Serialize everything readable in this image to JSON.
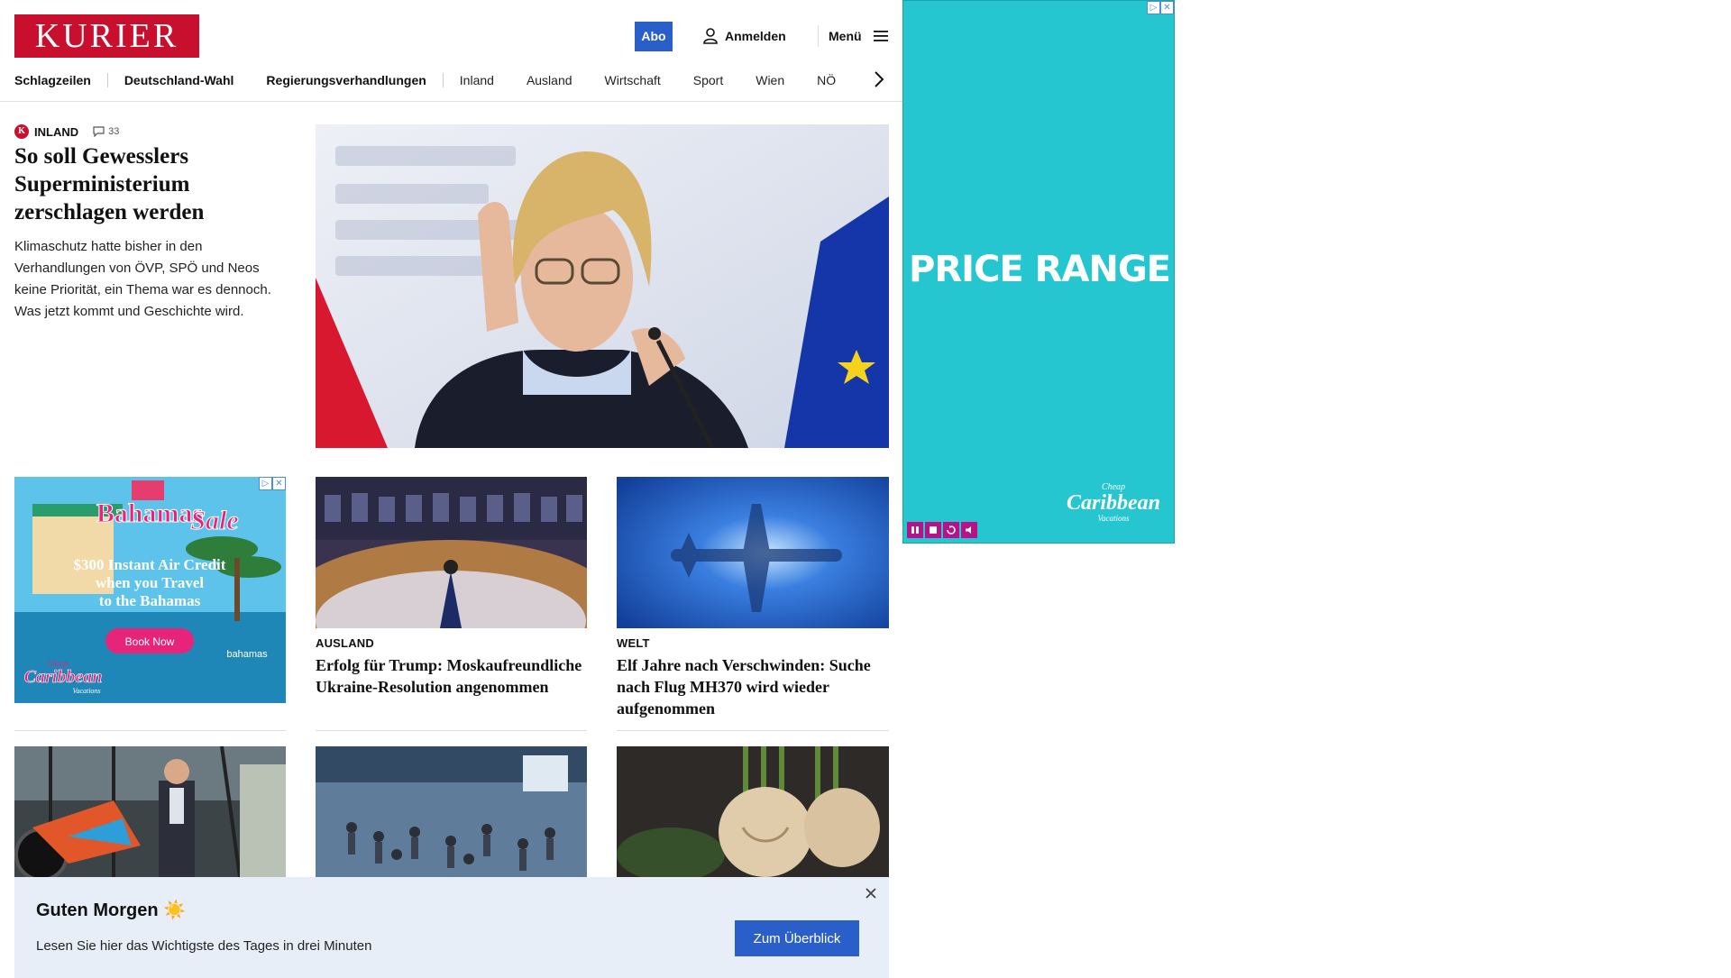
{
  "header": {
    "logo_text": "KURIER",
    "abo_label": "Abo",
    "login_label": "Anmelden",
    "menu_label": "Menü"
  },
  "nav": {
    "items": [
      {
        "label": "Schlagzeilen"
      },
      {
        "label": "Deutschland-Wahl"
      },
      {
        "label": "Regierungsverhandlungen"
      },
      {
        "label": "Inland"
      },
      {
        "label": "Ausland"
      },
      {
        "label": "Wirtschaft"
      },
      {
        "label": "Sport"
      },
      {
        "label": "Wien"
      },
      {
        "label": "NÖ"
      }
    ]
  },
  "lead": {
    "badge_letter": "K",
    "kicker": "INLAND",
    "comment_count": "33",
    "title": "So soll Gewesslers Superministerium zerschlagen werden",
    "teaser": "Klimaschutz hatte bisher in den Verhandlungen von ÖVP, SPÖ und Neos keine Priorität, ein Thema war es dennoch. Was jetzt kommt und Geschichte wird."
  },
  "cards": [
    {
      "kicker": "AUSLAND",
      "title": "Erfolg für Trump: Moskaufreundliche Ukraine-Resolution angenommen"
    },
    {
      "kicker": "WELT",
      "title": "Elf Jahre nach Verschwinden: Suche nach Flug MH370 wird wieder aufgenommen"
    }
  ],
  "ad_bahamas": {
    "headline_1": "Bahamas",
    "headline_2": "Sale",
    "offer_line_1": "$300 Instant Air Credit",
    "offer_line_2": "when you Travel",
    "offer_line_3": "to the Bahamas",
    "cta": "Book Now",
    "brand_small": "Cheap",
    "brand_main": "Caribbean",
    "brand_sub": "Vacations",
    "partner": "bahamas"
  },
  "ad_right": {
    "headline": "PRICE RANGE",
    "brand_small": "Cheap",
    "brand_main": "Caribbean",
    "brand_sub": "Vacations"
  },
  "greeting": {
    "title": "Guten Morgen",
    "emoji": "☀️",
    "subtitle": "Lesen Sie hier das Wichtigste des Tages in drei Minuten",
    "button": "Zum Überblick"
  },
  "colors": {
    "brand_red": "#c8102e",
    "accent_blue": "#2a5ec9",
    "ad_teal": "#26c6d0",
    "banner_bg": "#e8eef8"
  }
}
